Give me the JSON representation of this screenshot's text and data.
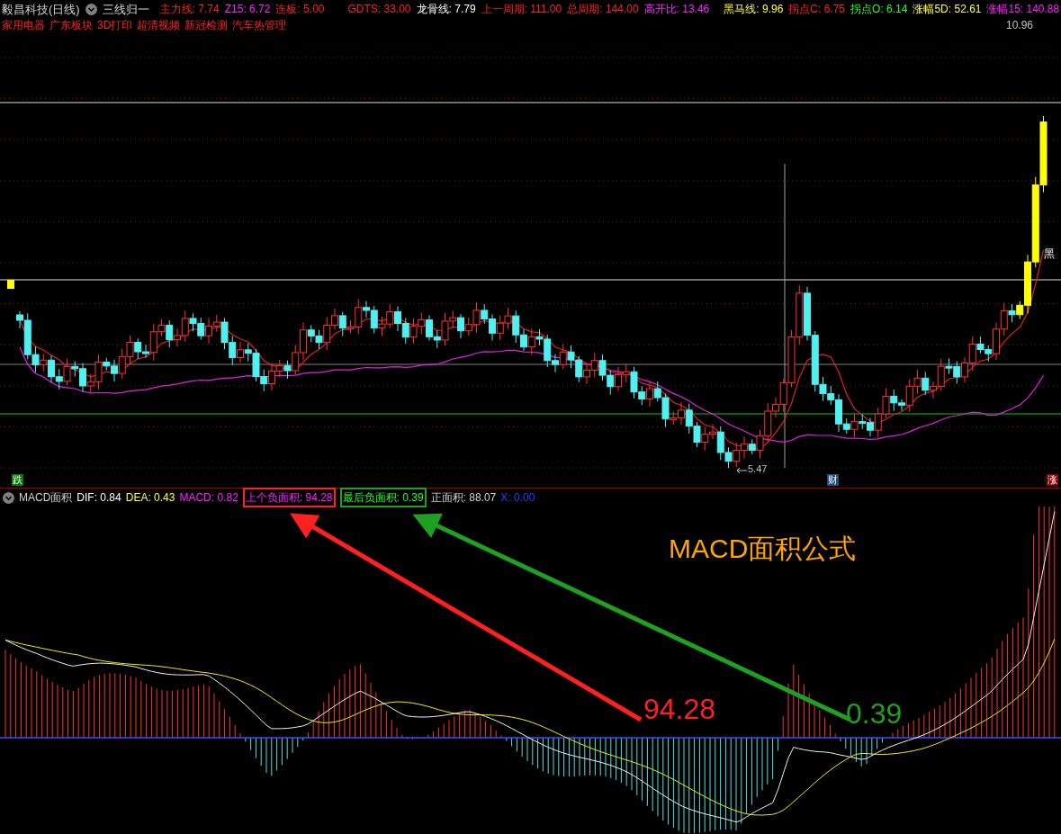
{
  "header": {
    "stock_name": "毅昌科技(日线)",
    "indicator": "三线归一",
    "readings": [
      {
        "label": "主力线:",
        "value": "7.74",
        "color": "#ff2020"
      },
      {
        "label": "Z15:",
        "value": "6.72",
        "color": "#ff20ff"
      },
      {
        "label": "连板:",
        "value": "5.00",
        "color": "#ff2020"
      },
      {
        "label": "GDTS:",
        "value": "33.00",
        "color": "#ff2020"
      },
      {
        "label": "龙骨线:",
        "value": "7.79",
        "color": "#ffffff"
      },
      {
        "label": "上一周期:",
        "value": "111.00",
        "color": "#ff2020"
      },
      {
        "label": "总周期:",
        "value": "144.00",
        "color": "#ff2020"
      },
      {
        "label": "高开比:",
        "value": "13.46",
        "color": "#ff20ff"
      },
      {
        "label": "黑马线:",
        "value": "9.96",
        "color": "#ffff40"
      },
      {
        "label": "拐点C:",
        "value": "6.75",
        "color": "#ff2020"
      },
      {
        "label": "拐点O:",
        "value": "6.14",
        "color": "#20ff20"
      },
      {
        "label": "涨幅5D:",
        "value": "52.61",
        "color": "#ffff40"
      },
      {
        "label": "涨幅15:",
        "value": "140.88",
        "color": "#ff20ff"
      }
    ]
  },
  "sectors": [
    "家用电器",
    "广东板块",
    "3D打印",
    "超清视频",
    "新冠检测",
    "汽车热管理"
  ],
  "price_chart": {
    "high_label": "10.96",
    "low_label": "5.47",
    "line_label": "黑",
    "badges": [
      {
        "text": "跌",
        "color": "#007a00"
      },
      {
        "text": "财",
        "color": "#1d4f80"
      },
      {
        "text": "涨",
        "color": "#8b0000"
      }
    ]
  },
  "macd": {
    "name": "MACD面积",
    "readings": [
      {
        "label": "DIF:",
        "value": "0.84",
        "color": "#ffffff",
        "boxed": false
      },
      {
        "label": "DEA:",
        "value": "0.43",
        "color": "#ffff40",
        "boxed": false
      },
      {
        "label": "MACD:",
        "value": "0.82",
        "color": "#ff20ff",
        "boxed": false
      },
      {
        "label": "上个负面积:",
        "value": "94.28",
        "color": "#ff20ff",
        "boxed": true
      },
      {
        "label": "最后负面积:",
        "value": "0.39",
        "color": "#20ff20",
        "boxed": true
      },
      {
        "label": "正面积:",
        "value": "88.07",
        "color": "#d0d0d0",
        "boxed": false
      },
      {
        "label": "X:",
        "value": "0.00",
        "color": "#2040ff",
        "boxed": false
      }
    ]
  },
  "annotations": {
    "title": "MACD面积公式",
    "callouts": [
      {
        "text": "94.28",
        "color": "#ff2020"
      },
      {
        "text": "0.39",
        "color": "#20a020"
      }
    ]
  }
}
